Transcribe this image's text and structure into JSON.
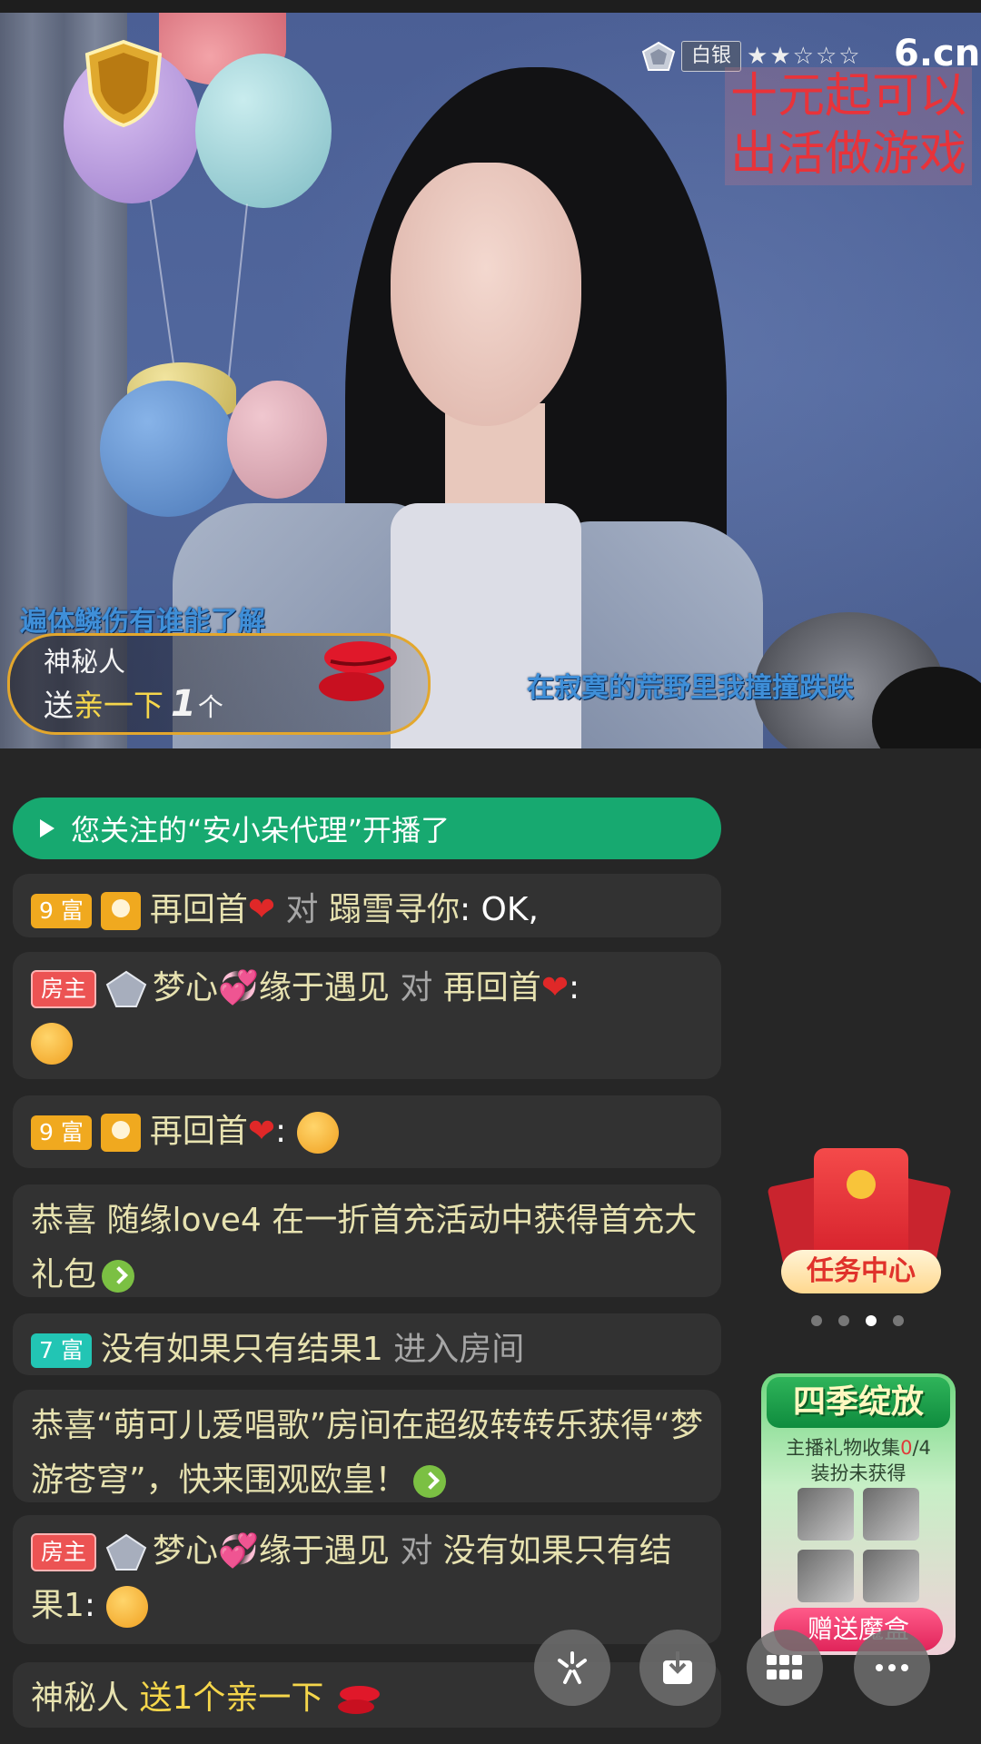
{
  "stream": {
    "rank_label": "白银",
    "rank_stars": "★★☆☆☆",
    "site_logo": "6.cn",
    "promo_text": "十元起可以出活做游戏",
    "lyric_left": "遍体鳞伤有谁能了解",
    "lyric_right": "在寂寞的荒野里我撞撞跌跌"
  },
  "gift_banner": {
    "user": "神秘人",
    "send_word": "送",
    "gift_name": "亲一下",
    "count": "1",
    "unit": "个"
  },
  "chat": {
    "notice": "您关注的“安小朵代理”开播了",
    "messages": [
      {
        "badge": "9 富",
        "name": "再回首",
        "to_word": "对",
        "target": "蹋雪寻你",
        "text": ": OK,"
      },
      {
        "badge": "房主",
        "name": "梦心",
        "name2": "缘于遇见",
        "to_word": "对",
        "target": "再回首",
        "text": ":"
      },
      {
        "badge": "9 富",
        "name": "再回首",
        "text": ":"
      },
      {
        "text": "恭喜 随缘love4 在一折首充活动中获得首充大礼包"
      },
      {
        "badge": "7 富",
        "name": "没有如果只有结果1",
        "text": "进入房间"
      },
      {
        "text": "恭喜“萌可儿爱唱歌”房间在超级转转乐获得“梦游苍穹”，快来围观欧皇！"
      },
      {
        "badge": "房主",
        "name": "梦心",
        "name2": "缘于遇见",
        "to_word": "对",
        "target": "没有如果只有结果1",
        "text": ":"
      },
      {
        "name": "神秘人",
        "text": "送1个亲一下"
      }
    ]
  },
  "side": {
    "task_center": "任务中心",
    "season_title": "四季绽放",
    "season_sub_label": "主播礼物收集",
    "season_progress": "0",
    "season_total": "/4",
    "season_status": "装扮未获得",
    "season_button": "赠送魔盒"
  },
  "colors": {
    "notice_bg": "#17a970",
    "gift_gold": "#f5d64b",
    "host_badge": "#ec5353",
    "rich9_badge": "#f0a91f",
    "rich7_badge": "#22c5b4"
  },
  "icons": [
    "sparkle-icon",
    "download-icon",
    "grid-icon",
    "more-icon"
  ]
}
